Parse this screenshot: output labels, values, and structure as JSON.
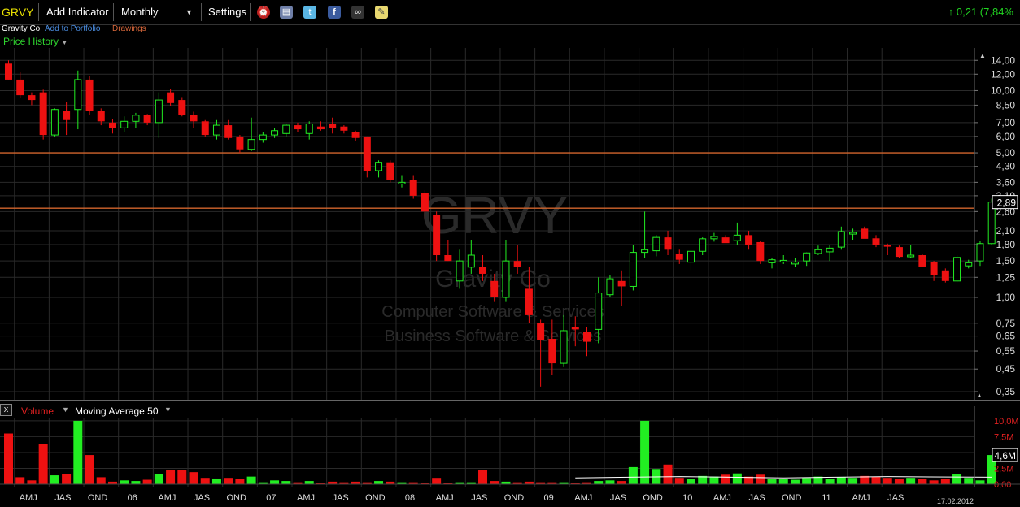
{
  "toolbar": {
    "ticker": "GRVY",
    "add_indicator": "Add Indicator",
    "period": "Monthly",
    "period_arrow": "▼",
    "settings": "Settings",
    "change_arrow": "↑",
    "change": "0,21 (7,84%"
  },
  "subheader": {
    "company": "Gravity Co",
    "add_portfolio": "Add to Portfolio",
    "drawings": "Drawings",
    "price_history": "Price History",
    "price_history_arrow": "▼"
  },
  "watermark": {
    "ticker": "GRVY",
    "company": "Gravity Co",
    "sector": "Computer Software & Services",
    "industry": "Business Software & Services"
  },
  "volume_panel": {
    "close": "x",
    "label": "Volume",
    "label_arrow": "▼",
    "indicator": "Moving Average 50",
    "indicator_arrow": "▼",
    "date": "17.02.2012"
  },
  "colors": {
    "up": "#22ee22",
    "down": "#ee1111",
    "line": "#d2652d",
    "grid": "#2a2a2a",
    "ma": "#ffffff"
  },
  "chart_data": [
    {
      "type": "candlestick",
      "title": "GRVY",
      "scale": "log",
      "ylim": [
        0.35,
        15.5
      ],
      "y_ticks": [
        "14,00",
        "12,00",
        "10,00",
        "8,50",
        "7,00",
        "6,00",
        "5,00",
        "4,30",
        "3,60",
        "3,10",
        "2,60",
        "2,10",
        "1,80",
        "1,50",
        "1,25",
        "1,00",
        "0,75",
        "0,65",
        "0,55",
        "0,45",
        "0,35"
      ],
      "y_tick_values": [
        14,
        12,
        10,
        8.5,
        7,
        6,
        5,
        4.3,
        3.6,
        3.1,
        2.6,
        2.1,
        1.8,
        1.5,
        1.25,
        1.0,
        0.75,
        0.65,
        0.55,
        0.45,
        0.35
      ],
      "last_price_label": "2,89",
      "horizontal_lines": [
        5.0,
        2.7
      ],
      "x_tick_labels": [
        "AMJ",
        "JAS",
        "OND",
        "06",
        "AMJ",
        "JAS",
        "OND",
        "07",
        "AMJ",
        "JAS",
        "OND",
        "08",
        "AMJ",
        "JAS",
        "OND",
        "09",
        "AMJ",
        "JAS",
        "OND",
        "10",
        "AMJ",
        "JAS",
        "OND",
        "11",
        "AMJ",
        "JAS"
      ],
      "x_tick_months": [
        4,
        7,
        10,
        13,
        16,
        19,
        22,
        25,
        28,
        31,
        34,
        37,
        40,
        43,
        46,
        49,
        52,
        55,
        58,
        61,
        64,
        67,
        70,
        73,
        76,
        79
      ],
      "ohlc": [
        [
          13.5,
          14.0,
          11.3,
          11.3
        ],
        [
          11.3,
          12.3,
          9.2,
          9.5
        ],
        [
          9.5,
          9.8,
          8.5,
          9.0
        ],
        [
          9.8,
          10.1,
          5.8,
          6.1
        ],
        [
          6.1,
          8.2,
          6.0,
          8.1
        ],
        [
          8.0,
          8.8,
          6.1,
          7.2
        ],
        [
          8.1,
          12.5,
          6.5,
          11.3
        ],
        [
          11.3,
          11.8,
          7.6,
          8.0
        ],
        [
          8.0,
          8.2,
          6.8,
          7.1
        ],
        [
          7.0,
          7.3,
          6.2,
          6.6
        ],
        [
          6.6,
          7.5,
          6.3,
          7.1
        ],
        [
          7.1,
          7.8,
          6.6,
          7.6
        ],
        [
          7.6,
          7.7,
          6.8,
          7.0
        ],
        [
          7.0,
          9.8,
          5.9,
          9.0
        ],
        [
          9.8,
          10.2,
          8.4,
          8.7
        ],
        [
          9.0,
          9.3,
          7.5,
          7.6
        ],
        [
          7.6,
          7.9,
          6.6,
          7.1
        ],
        [
          7.1,
          7.2,
          6.0,
          6.1
        ],
        [
          6.1,
          7.2,
          5.8,
          6.8
        ],
        [
          6.8,
          7.2,
          5.8,
          5.9
        ],
        [
          6.0,
          6.1,
          5.0,
          5.2
        ],
        [
          5.2,
          7.4,
          5.1,
          5.8
        ],
        [
          5.8,
          6.3,
          5.6,
          6.1
        ],
        [
          6.1,
          6.6,
          5.9,
          6.4
        ],
        [
          6.2,
          6.9,
          6.0,
          6.8
        ],
        [
          6.8,
          7.0,
          6.3,
          6.5
        ],
        [
          6.2,
          7.1,
          5.8,
          6.9
        ],
        [
          6.7,
          7.1,
          6.4,
          6.5
        ],
        [
          6.9,
          7.4,
          6.2,
          6.6
        ],
        [
          6.7,
          6.8,
          6.2,
          6.4
        ],
        [
          6.3,
          6.4,
          5.7,
          5.9
        ],
        [
          6.0,
          6.0,
          3.8,
          4.1
        ],
        [
          4.1,
          4.6,
          3.8,
          4.5
        ],
        [
          4.5,
          4.6,
          3.6,
          3.7
        ],
        [
          3.6,
          3.9,
          3.4,
          3.6
        ],
        [
          3.7,
          3.9,
          3.0,
          3.1
        ],
        [
          3.2,
          3.3,
          2.4,
          2.6
        ],
        [
          2.5,
          2.6,
          1.5,
          1.6
        ],
        [
          1.6,
          1.9,
          1.5,
          1.5
        ],
        [
          1.2,
          1.7,
          1.1,
          1.5
        ],
        [
          1.4,
          1.9,
          1.3,
          1.6
        ],
        [
          1.4,
          1.6,
          1.2,
          1.3
        ],
        [
          1.2,
          1.3,
          0.95,
          1.0
        ],
        [
          1.0,
          1.9,
          0.95,
          1.5
        ],
        [
          1.5,
          1.8,
          1.3,
          1.4
        ],
        [
          1.1,
          1.4,
          0.75,
          0.82
        ],
        [
          0.75,
          0.78,
          0.37,
          0.62
        ],
        [
          0.63,
          0.78,
          0.42,
          0.48
        ],
        [
          0.48,
          0.82,
          0.46,
          0.69
        ],
        [
          0.72,
          0.81,
          0.58,
          0.7
        ],
        [
          0.68,
          0.72,
          0.52,
          0.61
        ],
        [
          0.7,
          1.25,
          0.6,
          1.05
        ],
        [
          1.03,
          1.28,
          1.0,
          1.23
        ],
        [
          1.2,
          1.35,
          0.91,
          1.13
        ],
        [
          1.13,
          1.8,
          1.08,
          1.65
        ],
        [
          1.65,
          2.6,
          1.55,
          1.7
        ],
        [
          1.68,
          2.0,
          1.58,
          1.95
        ],
        [
          1.95,
          2.1,
          1.6,
          1.7
        ],
        [
          1.62,
          1.7,
          1.45,
          1.52
        ],
        [
          1.48,
          1.7,
          1.35,
          1.67
        ],
        [
          1.67,
          1.95,
          1.6,
          1.92
        ],
        [
          1.92,
          2.05,
          1.86,
          1.97
        ],
        [
          1.95,
          2.0,
          1.84,
          1.83
        ],
        [
          1.88,
          2.3,
          1.8,
          2.0
        ],
        [
          2.0,
          2.1,
          1.7,
          1.8
        ],
        [
          1.85,
          1.88,
          1.45,
          1.5
        ],
        [
          1.47,
          1.55,
          1.38,
          1.52
        ],
        [
          1.5,
          1.6,
          1.45,
          1.51
        ],
        [
          1.45,
          1.55,
          1.4,
          1.48
        ],
        [
          1.5,
          1.65,
          1.42,
          1.64
        ],
        [
          1.63,
          1.78,
          1.6,
          1.7
        ],
        [
          1.66,
          1.8,
          1.5,
          1.73
        ],
        [
          1.75,
          2.2,
          1.7,
          2.08
        ],
        [
          2.05,
          2.15,
          1.9,
          2.06
        ],
        [
          2.15,
          2.2,
          1.95,
          1.92
        ],
        [
          1.93,
          2.0,
          1.75,
          1.8
        ],
        [
          1.79,
          1.82,
          1.6,
          1.77
        ],
        [
          1.75,
          1.78,
          1.55,
          1.57
        ],
        [
          1.58,
          1.8,
          1.55,
          1.6
        ],
        [
          1.6,
          1.62,
          1.4,
          1.41
        ],
        [
          1.48,
          1.5,
          1.2,
          1.28
        ],
        [
          1.35,
          1.38,
          1.18,
          1.2
        ],
        [
          1.2,
          1.6,
          1.18,
          1.56
        ],
        [
          1.42,
          1.52,
          1.38,
          1.47
        ],
        [
          1.5,
          1.88,
          1.42,
          1.82
        ],
        [
          1.82,
          3.0,
          1.8,
          2.89
        ]
      ]
    },
    {
      "type": "bar",
      "title": "Volume",
      "ylim": [
        0,
        10.5
      ],
      "y_ticks": [
        "10,0M",
        "7,5M",
        "5,0M",
        "2,5M",
        "0,00"
      ],
      "y_tick_values": [
        10,
        7.5,
        5.0,
        2.5,
        0
      ],
      "last_value_label": "4,6M",
      "values_millions": [
        8.0,
        1.1,
        0.6,
        6.3,
        1.4,
        1.6,
        10.0,
        4.6,
        1.1,
        0.4,
        0.6,
        0.5,
        0.7,
        1.6,
        2.3,
        2.2,
        1.9,
        1.0,
        0.9,
        1.0,
        0.8,
        1.2,
        0.3,
        0.6,
        0.5,
        0.3,
        0.5,
        0.2,
        0.4,
        0.3,
        0.4,
        0.3,
        0.5,
        0.4,
        0.3,
        0.3,
        0.2,
        1.0,
        0.2,
        0.3,
        0.3,
        2.2,
        0.5,
        0.4,
        0.3,
        0.4,
        0.3,
        0.3,
        0.3,
        0.2,
        0.3,
        0.5,
        0.6,
        0.5,
        2.7,
        10.0,
        2.4,
        3.1,
        1.0,
        0.8,
        1.3,
        1.2,
        1.5,
        1.7,
        1.2,
        1.5,
        0.9,
        0.8,
        0.7,
        1.0,
        1.2,
        0.9,
        1.1,
        1.0,
        1.3,
        1.2,
        1.0,
        0.9,
        1.0,
        0.8,
        0.6,
        0.9,
        1.6,
        1.0,
        0.6,
        4.6
      ],
      "ma50_millions": [
        1.0,
        1.2,
        1.0,
        1.2,
        1.1
      ]
    }
  ]
}
